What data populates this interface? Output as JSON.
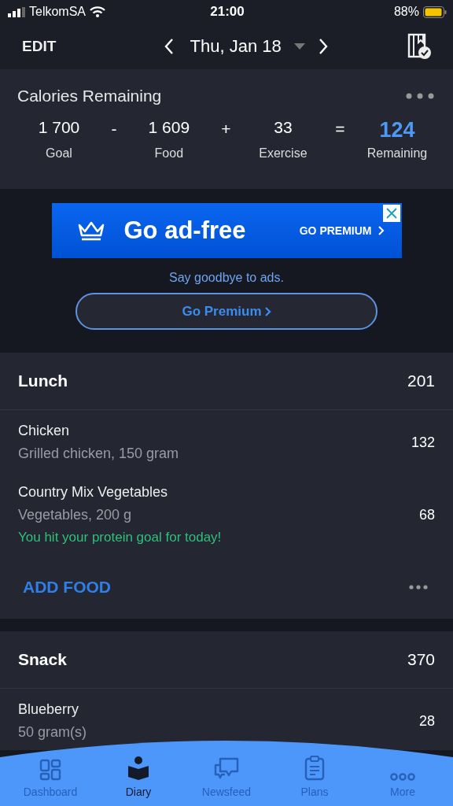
{
  "status_bar": {
    "carrier": "TelkomSA",
    "time": "21:00",
    "battery": "88%"
  },
  "header": {
    "edit": "EDIT",
    "date": "Thu, Jan 18"
  },
  "calories": {
    "title": "Calories Remaining",
    "items": [
      {
        "kind": "value",
        "value": "1 700",
        "label": "Goal"
      },
      {
        "kind": "operator",
        "symbol": "-"
      },
      {
        "kind": "value",
        "value": "1 609",
        "label": "Food"
      },
      {
        "kind": "operator",
        "symbol": "+"
      },
      {
        "kind": "value",
        "value": "33",
        "label": "Exercise"
      },
      {
        "kind": "operator",
        "symbol": "="
      },
      {
        "kind": "result",
        "value": "124",
        "label": "Remaining"
      }
    ]
  },
  "ad": {
    "headline": "Go ad-free",
    "cta": "GO PREMIUM",
    "tagline": "Say goodbye to ads.",
    "button": "Go Premium"
  },
  "meals": [
    {
      "name": "Lunch",
      "calories": "201",
      "add_food": "ADD FOOD",
      "foods": [
        {
          "name": "Chicken",
          "detail": "Grilled chicken, 150 gram",
          "calories": "132"
        },
        {
          "name": "Country Mix Vegetables",
          "detail": "Vegetables, 200 g",
          "calories": "68",
          "note": "You hit your protein goal for today!"
        }
      ]
    },
    {
      "name": "Snack",
      "calories": "370",
      "foods": [
        {
          "name": "Blueberry",
          "detail": "50 gram(s)",
          "calories": "28"
        }
      ]
    }
  ],
  "tab_bar": [
    {
      "kind": "dashboard",
      "label": "Dashboard",
      "selected": false
    },
    {
      "kind": "diary",
      "label": "Diary",
      "selected": true
    },
    {
      "kind": "newsfeed",
      "label": "Newsfeed",
      "selected": false
    },
    {
      "kind": "plans",
      "label": "Plans",
      "selected": false
    },
    {
      "kind": "more",
      "label": "More",
      "selected": false
    }
  ]
}
